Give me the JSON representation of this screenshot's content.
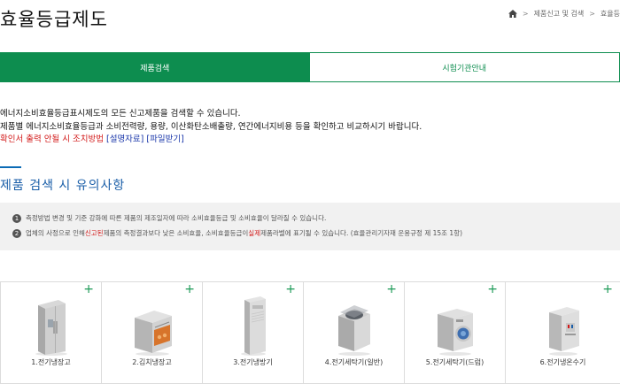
{
  "page": {
    "title": "효율등급제도"
  },
  "breadcrumb": {
    "home_icon": "home-icon",
    "items": [
      "제품신고 및 검색",
      "효율등"
    ]
  },
  "tabs": [
    {
      "label": "제품검색",
      "active": true
    },
    {
      "label": "시험기관안내",
      "active": false
    }
  ],
  "intro": {
    "line1": "에너지소비효율등급표시제도의 모든 신고제품을 검색할 수 있습니다.",
    "line2": "제품별 에너지소비효율등급과 소비전력량, 용량, 이산화탄소배출량, 연간에너지비용 등을 확인하고 비교하시기 바랍니다.",
    "line3_prefix": "확인서 출력 안될 시 조치방법",
    "link_manual": "[설명자료]",
    "link_file": "[파일받기]"
  },
  "notice": {
    "title": "제품 검색 시 유의사항",
    "item1_num": "1",
    "item1": "측정방법 변경 및 기준 강화에 따른 제품의 제조일자에 따라 소비효율등급 및 소비효율이 달라질 수 있습니다.",
    "item2_num": "2",
    "item2_a": "업체의 사정으로 인해 ",
    "item2_red1": "신고된",
    "item2_b": " 제품의 측정결과보다 낮은 소비효율, 소비효율등급이 ",
    "item2_red2": "실제",
    "item2_c": "제품라벨에 표기될 수 있습니다. (효율관리기자재 운용규정 제 15조 1항)"
  },
  "products": [
    {
      "label": "1.전기냉장고",
      "icon": "refrigerator-icon",
      "plus": "+"
    },
    {
      "label": "2.김치냉장고",
      "icon": "kimchi-refrigerator-icon",
      "plus": "+"
    },
    {
      "label": "3.전기냉방기",
      "icon": "air-conditioner-icon",
      "plus": "+"
    },
    {
      "label": "4.전기세탁기(일반)",
      "icon": "washing-machine-top-icon",
      "plus": "+"
    },
    {
      "label": "5.전기세탁기(드럼)",
      "icon": "washing-machine-drum-icon",
      "plus": "+"
    },
    {
      "label": "6.전기냉온수기",
      "icon": "water-dispenser-icon",
      "plus": "+"
    }
  ],
  "colors": {
    "accent": "#0d8d4f",
    "title_blue": "#1a5ea8",
    "red": "#d21818",
    "link_blue": "#1633a8"
  }
}
